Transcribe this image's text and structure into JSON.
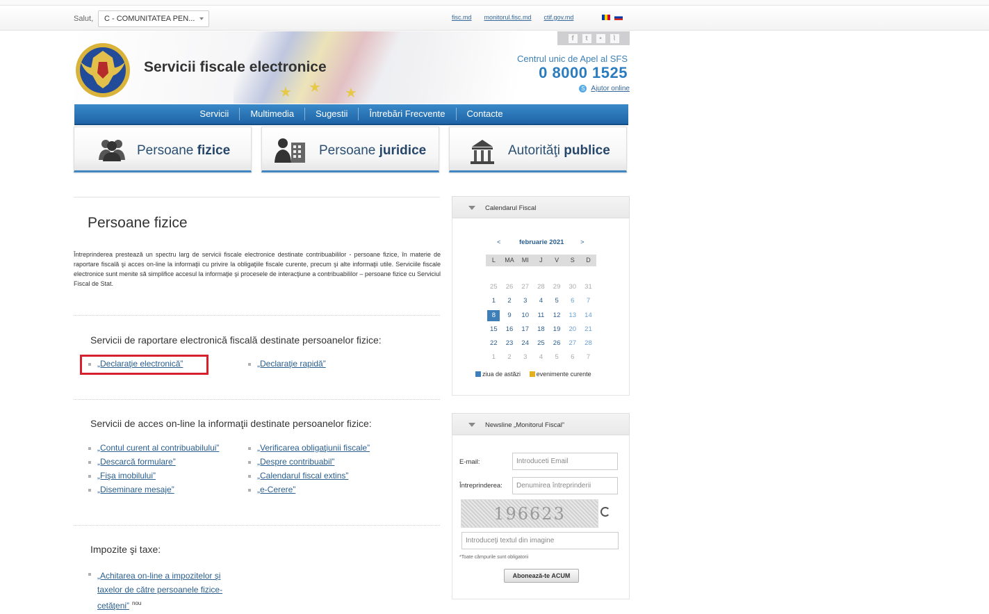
{
  "topbar": {
    "greeting": "Salut,",
    "user_value": "C - COMUNITATEA PEN...",
    "links": [
      "fisc.md",
      "monitorul.fisc.md",
      "ctif.gov.md"
    ]
  },
  "header": {
    "site_title": "Servicii fiscale electronice",
    "call_center": "Centrul unic de Apel al SFS",
    "phone": "0 8000 1525",
    "help_link": "Ajutor online"
  },
  "nav": [
    "Servicii",
    "Multimedia",
    "Sugestii",
    "Întrebări Frecvente",
    "Contacte"
  ],
  "tabs": [
    {
      "label_a": "Persoane ",
      "label_b": "fizice"
    },
    {
      "label_a": "Persoane ",
      "label_b": "juridice"
    },
    {
      "label_a": "Autorităţi ",
      "label_b": "publice"
    }
  ],
  "main": {
    "title": "Persoane fizice",
    "intro": "Întreprinderea prestează un spectru larg de servicii fiscale electronice destinate contribuabililor - persoane fizice, în materie de raportare fiscală şi acces on-line la informaţii cu privire la obligaţiile fiscale curente, precum şi alte informaţii utile. Serviciile fiscale electronice sunt menite să simplifice accesul la informaţie şi procesele de interacţiune a contribuabililor – persoane fizice cu Serviciul Fiscal de Stat.",
    "section1": {
      "heading": "Servicii de raportare electronică fiscală destinate persoanelor fizice:",
      "left": [
        "„Declaraţie electronică”"
      ],
      "right": [
        "„Declaraţie rapidă”"
      ]
    },
    "section2": {
      "heading": "Servicii de acces on-line la informaţii destinate persoanelor fizice:",
      "left": [
        "„Contul curent al contribuabilului”",
        "„Descarcă formulare”",
        "„Fişa imobilului”",
        "„Diseminare mesaje”"
      ],
      "right": [
        "„Verificarea obligaţiunii fiscale”",
        "„Despre contribuabil”",
        "„Calendarul fiscal extins”",
        "„e-Cerere”"
      ]
    },
    "section3": {
      "heading": "Impozite şi taxe:",
      "link_l1": "„Achitarea on-line a impozitelor şi",
      "link_l2": "taxelor de către persoanele fizice-",
      "link_l3": "cetăţeni”",
      "badge": "nou"
    }
  },
  "calendar": {
    "heading": "Calendarul Fiscal",
    "prev": "<",
    "next": ">",
    "month": "februarie 2021",
    "weekdays": [
      "L",
      "MA",
      "MI",
      "J",
      "V",
      "S",
      "D"
    ],
    "weeks": [
      [
        "25",
        "26",
        "27",
        "28",
        "29",
        "30",
        "31"
      ],
      [
        "1",
        "2",
        "3",
        "4",
        "5",
        "6",
        "7"
      ],
      [
        "8",
        "9",
        "10",
        "11",
        "12",
        "13",
        "14"
      ],
      [
        "15",
        "16",
        "17",
        "18",
        "19",
        "20",
        "21"
      ],
      [
        "22",
        "23",
        "24",
        "25",
        "26",
        "27",
        "28"
      ],
      [
        "1",
        "2",
        "3",
        "4",
        "5",
        "6",
        "7"
      ]
    ],
    "today": "8",
    "legend_today": "ziua de astăzi",
    "legend_events": "evenimente curente",
    "today_color": "#3f7fb7",
    "events_color": "#e2b020"
  },
  "newsletter": {
    "heading": "Newsline „Monitorul Fiscal”",
    "email_label": "E-mail:",
    "email_placeholder": "Introduceti Email",
    "company_label": "Întreprinderea:",
    "company_placeholder": "Denumirea întreprinderii",
    "captcha_text": "196623",
    "captcha_placeholder": "Introduceţi textul din imagine",
    "required_note": "*Toate câmpurile sunt obligatorii",
    "subscribe": "Abonează-te ACUM"
  }
}
